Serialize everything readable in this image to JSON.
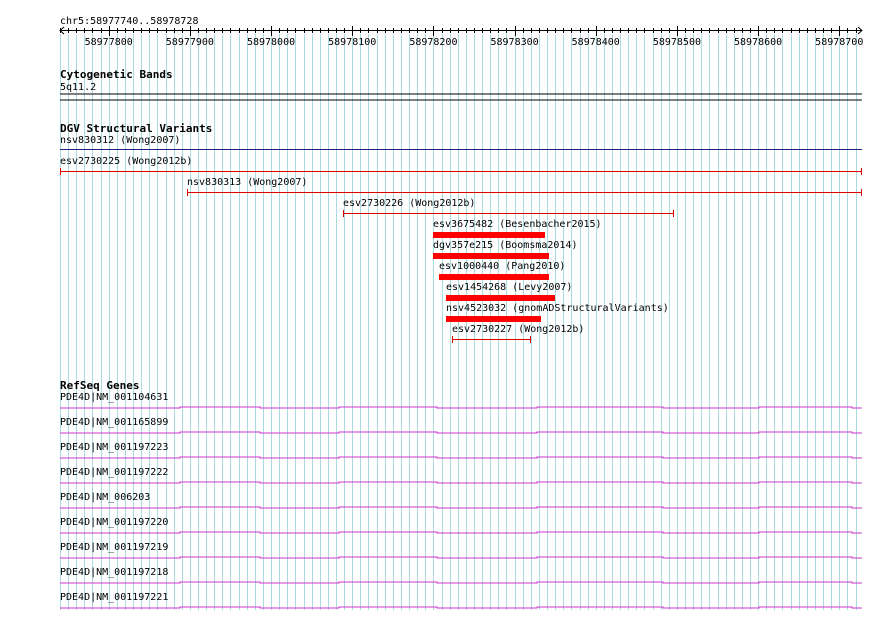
{
  "ruler": {
    "location": "chr5:58977740..58978728",
    "start": 58977740,
    "end": 58978728,
    "tick_labels": [
      58977800,
      58977900,
      58978000,
      58978100,
      58978200,
      58978300,
      58978400,
      58978500,
      58978600,
      58978700
    ]
  },
  "cytoband": {
    "title": "Cytogenetic Bands",
    "band": "5q11.2"
  },
  "dgv": {
    "title": "DGV Structural Variants",
    "variants": [
      {
        "label": "nsv830312 (Wong2007)",
        "start": 58977740,
        "end": 58978728,
        "style": "full",
        "color": "#1a237e"
      },
      {
        "label": "esv2730225 (Wong2012b)",
        "start": 58977740,
        "end": 58978728,
        "style": "range",
        "color": "#e00000"
      },
      {
        "label": "nsv830313 (Wong2007)",
        "start": 58977897,
        "end": 58978728,
        "style": "range",
        "color": "#e00000"
      },
      {
        "label": "esv2730226 (Wong2012b)",
        "start": 58978089,
        "end": 58978496,
        "style": "range",
        "color": "#e00000"
      },
      {
        "label": "esv3675482 (Besenbacher2015)",
        "start": 58978200,
        "end": 58978337,
        "style": "bar",
        "color": "#ff0000"
      },
      {
        "label": "dgv357e215 (Boomsma2014)",
        "start": 58978200,
        "end": 58978342,
        "style": "bar",
        "color": "#ff0000"
      },
      {
        "label": "esv1000440 (Pang2010)",
        "start": 58978207,
        "end": 58978342,
        "style": "bar",
        "color": "#ff0000"
      },
      {
        "label": "esv1454268 (Levy2007)",
        "start": 58978215,
        "end": 58978350,
        "style": "bar",
        "color": "#ff0000"
      },
      {
        "label": "nsv4523032 (gnomADStructuralVariants)",
        "start": 58978215,
        "end": 58978332,
        "style": "bar",
        "color": "#ff0000"
      },
      {
        "label": "esv2730227 (Wong2012b)",
        "start": 58978223,
        "end": 58978320,
        "style": "range",
        "color": "#e00000"
      }
    ]
  },
  "refseq": {
    "title": "RefSeq Genes",
    "color": "#cc33cc",
    "genes": [
      "PDE4D|NM_001104631",
      "PDE4D|NM_001165899",
      "PDE4D|NM_001197223",
      "PDE4D|NM_001197222",
      "PDE4D|NM_006203",
      "PDE4D|NM_001197220",
      "PDE4D|NM_001197219",
      "PDE4D|NM_001197218",
      "PDE4D|NM_001197221"
    ]
  },
  "colors": {
    "grid": "#a8dce0",
    "axis": "#000000"
  }
}
